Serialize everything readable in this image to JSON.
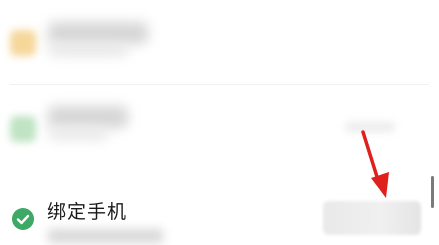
{
  "list": {
    "bind_phone": {
      "title": "绑定手机"
    }
  },
  "colors": {
    "check_green": "#3ea866",
    "annotation_arrow": "#e0201c"
  },
  "icons": {
    "status": "check-circle-icon",
    "annotation": "red-arrow-icon"
  }
}
